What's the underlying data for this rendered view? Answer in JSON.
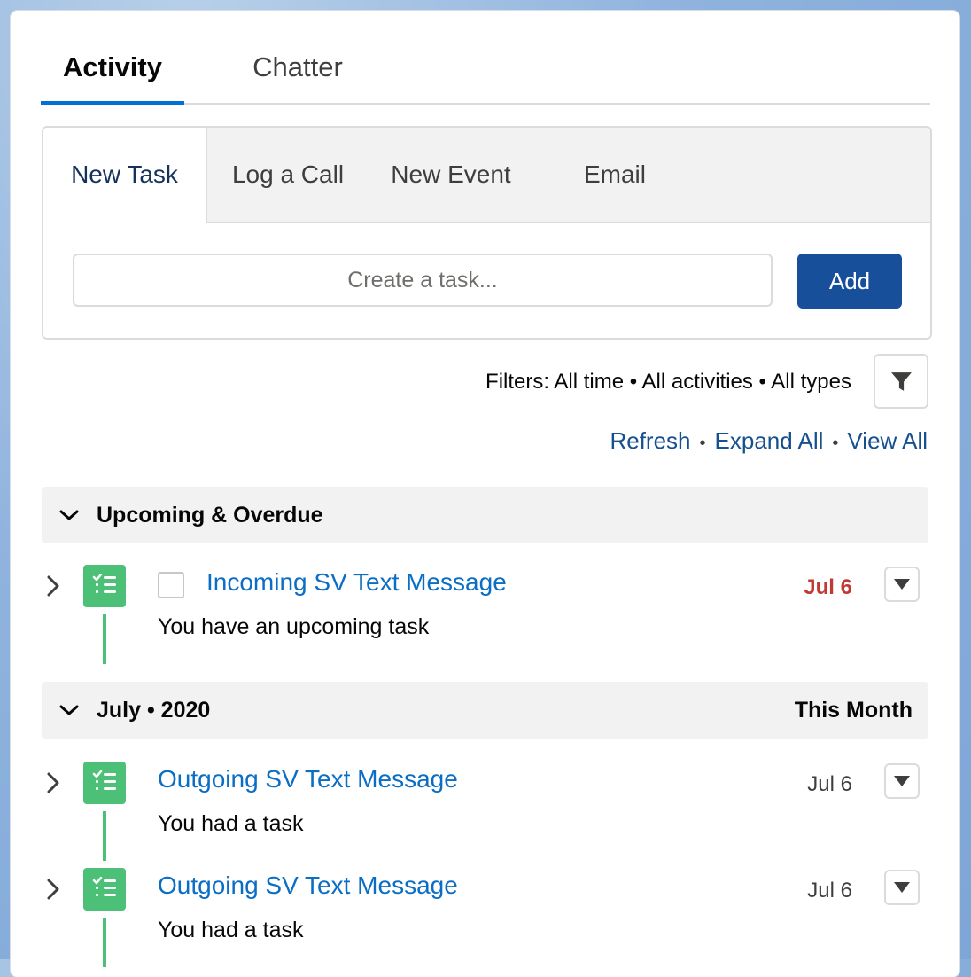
{
  "main_tabs": [
    {
      "label": "Activity",
      "active": true
    },
    {
      "label": "Chatter",
      "active": false
    }
  ],
  "publisher": {
    "tabs": [
      {
        "label": "New Task",
        "active": true
      },
      {
        "label": "Log a Call",
        "active": false
      },
      {
        "label": "New Event",
        "active": false
      },
      {
        "label": "Email",
        "active": false
      }
    ],
    "task_input": {
      "placeholder": "Create a task...",
      "value": ""
    },
    "add_label": "Add"
  },
  "filters": {
    "prefix": "Filters:",
    "time": "All time",
    "activities": "All activities",
    "types": "All types",
    "separator": "•"
  },
  "links": {
    "refresh": "Refresh",
    "expand_all": "Expand All",
    "view_all": "View All",
    "separator": "•"
  },
  "sections": [
    {
      "title": "Upcoming & Overdue",
      "right_label": "",
      "items": [
        {
          "subject": "Incoming SV Text Message",
          "description": "You have an upcoming task",
          "date": "Jul 6",
          "overdue": true,
          "has_checkbox": true
        }
      ]
    },
    {
      "title": "July • 2020",
      "right_label": "This Month",
      "items": [
        {
          "subject": "Outgoing SV Text Message",
          "description": "You had a task",
          "date": "Jul 6",
          "overdue": false,
          "has_checkbox": false
        },
        {
          "subject": "Outgoing SV Text Message",
          "description": "You had a task",
          "date": "Jul 6",
          "overdue": false,
          "has_checkbox": false
        }
      ]
    }
  ],
  "icons": {
    "filter": "filter-funnel-icon",
    "task": "task-list-icon",
    "chevron_down": "chevron-down-icon",
    "chevron_right": "chevron-right-icon",
    "menu_down": "triangle-down-icon"
  },
  "colors": {
    "brand_blue": "#174f9b",
    "link_blue": "#0b6ec5",
    "task_green": "#4bc076",
    "overdue_red": "#c23934",
    "active_tab_underline": "#0070d2"
  }
}
